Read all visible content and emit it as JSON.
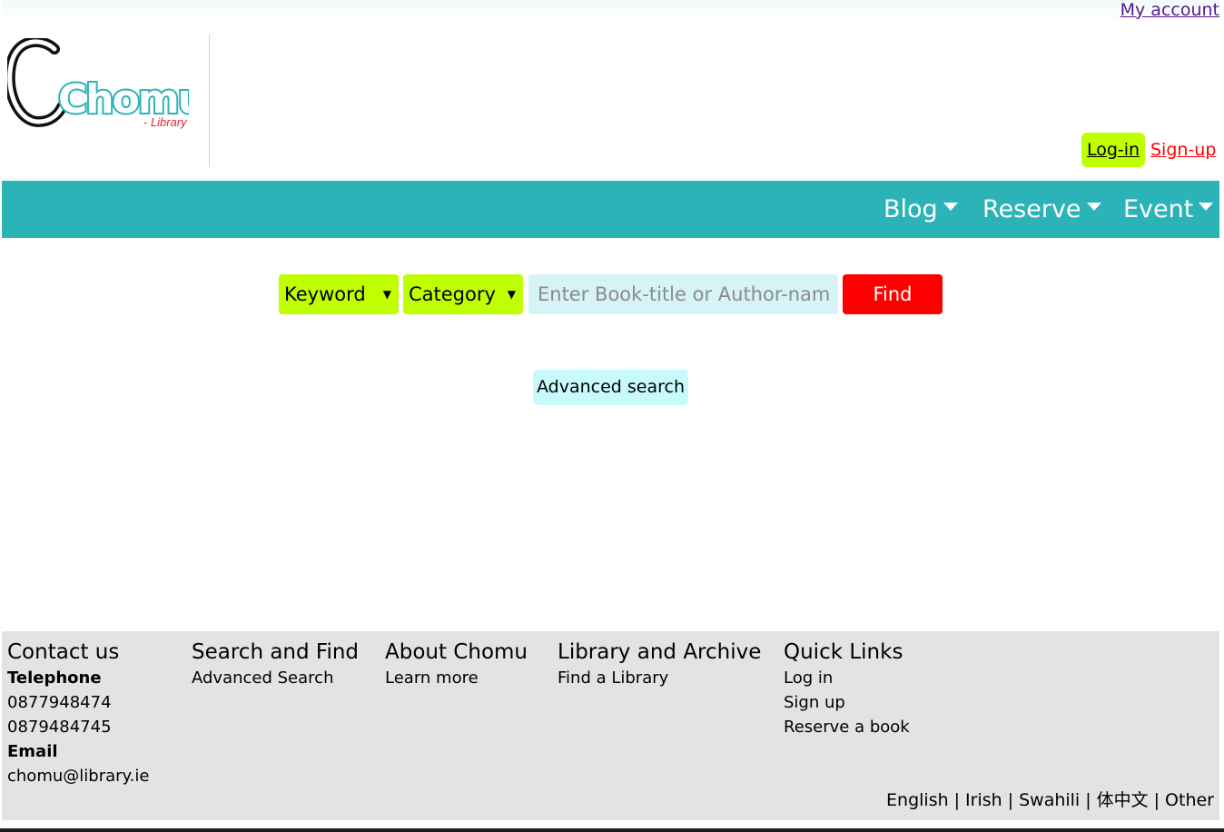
{
  "header": {
    "my_account": "My account",
    "login": "Log-in",
    "signup": "Sign-up",
    "logo": {
      "main": "Chomu",
      "sub": "- Library"
    }
  },
  "nav": [
    {
      "label": "Blog"
    },
    {
      "label": "Reserve"
    },
    {
      "label": "Event"
    }
  ],
  "search": {
    "type_select": "Keyword",
    "category_select": "Category",
    "placeholder": "Enter Book-title or Author-name",
    "find_label": "Find",
    "advanced_label": "Advanced search"
  },
  "footer": {
    "contact": {
      "title": "Contact us",
      "telephone_label": "Telephone",
      "phones": [
        "0877948474",
        "0879484745"
      ],
      "email_label": "Email",
      "email": "chomu@library.ie"
    },
    "search_find": {
      "title": "Search and Find",
      "links": [
        "Advanced Search"
      ]
    },
    "about": {
      "title": "About Chomu",
      "links": [
        "Learn more"
      ]
    },
    "library_archive": {
      "title": "Library and Archive",
      "links": [
        "Find a Library"
      ]
    },
    "quick_links": {
      "title": "Quick Links",
      "links": [
        "Log in",
        "Sign up",
        "Reserve a book"
      ]
    },
    "languages": [
      "English",
      "Irish",
      "Swahili",
      "体中文",
      "Other"
    ]
  },
  "colors": {
    "nav_bg": "#2bb3b8",
    "accent_lime": "#bfff00",
    "find_red": "#ff0000",
    "input_bg": "#d6f4f5",
    "advanced_bg": "#c7fbfb",
    "footer_bg": "#e3e3e3"
  }
}
